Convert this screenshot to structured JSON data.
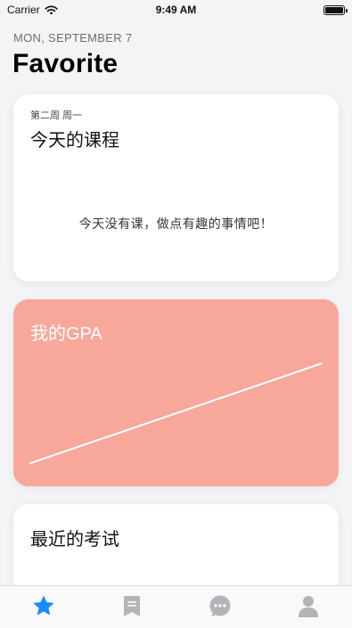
{
  "status_bar": {
    "carrier": "Carrier",
    "time": "9:49 AM"
  },
  "header": {
    "date": "MON, SEPTEMBER 7",
    "title": "Favorite"
  },
  "schedule_card": {
    "week": "第二周 周一",
    "title": "今天的课程",
    "empty_message": "今天没有课，做点有趣的事情吧！"
  },
  "gpa_card": {
    "title": "我的GPA",
    "background_color": "#f7a89b"
  },
  "exam_card": {
    "title": "最近的考试"
  },
  "tab_bar": {
    "tabs": [
      {
        "icon": "star-icon",
        "selected": true
      },
      {
        "icon": "bookmark-icon",
        "selected": false
      },
      {
        "icon": "chat-bubble-icon",
        "selected": false
      },
      {
        "icon": "person-icon",
        "selected": false
      }
    ],
    "active_color": "#1a8cff",
    "inactive_color": "#b3b3b8"
  }
}
